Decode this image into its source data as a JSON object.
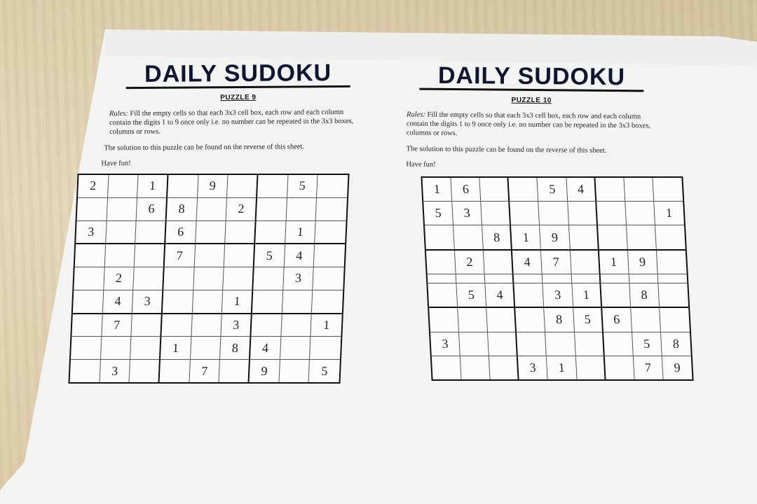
{
  "puzzles": [
    {
      "title": "DAILY SUDOKU",
      "label": "PUZZLE 9",
      "rules_prefix": "Rules:",
      "rules": "Fill the empty cells so that each 3x3 cell box, each row and each column contain the digits 1 to 9 once only i.e. no number can be repeated in the 3x3 boxes, columns or rows.",
      "solution_note": "The solution to this puzzle can be found on the reverse of this sheet.",
      "have_fun": "Have fun!",
      "grid": [
        [
          "2",
          "",
          "1",
          "",
          "9",
          "",
          "",
          "5",
          ""
        ],
        [
          "",
          "",
          "6",
          "8",
          "",
          "2",
          "",
          "",
          ""
        ],
        [
          "3",
          "",
          "",
          "6",
          "",
          "",
          "",
          "1",
          ""
        ],
        [
          "",
          "",
          "",
          "7",
          "",
          "",
          "5",
          "4",
          ""
        ],
        [
          "",
          "2",
          "",
          "",
          "",
          "",
          "",
          "3",
          ""
        ],
        [
          "",
          "4",
          "3",
          "",
          "",
          "1",
          "",
          "",
          ""
        ],
        [
          "",
          "7",
          "",
          "",
          "",
          "3",
          "",
          "",
          "1"
        ],
        [
          "",
          "",
          "",
          "1",
          "",
          "8",
          "4",
          "",
          ""
        ],
        [
          "",
          "3",
          "",
          "",
          "7",
          "",
          "9",
          "",
          "5"
        ]
      ]
    },
    {
      "title": "DAILY SUDOKU",
      "label": "PUZZLE 10",
      "rules_prefix": "Rules:",
      "rules": "Fill the empty cells so that each 3x3 cell box, each row and each column contain the digits 1 to 9 once only i.e. no number can be repeated in the 3x3 boxes, columns or rows.",
      "solution_note": "The solution to this puzzle can be found on the reverse of this sheet.",
      "have_fun": "Have fun!",
      "grid": [
        [
          "1",
          "6",
          "",
          "",
          "5",
          "4",
          "",
          "",
          ""
        ],
        [
          "5",
          "3",
          "",
          "",
          "",
          "",
          "",
          "",
          "1"
        ],
        [
          "",
          "",
          "8",
          "1",
          "9",
          "",
          "",
          "",
          ""
        ],
        [
          "",
          "2",
          "",
          "4",
          "7",
          "",
          "1",
          "9",
          ""
        ],
        [
          "",
          "",
          "",
          "",
          "",
          "",
          "",
          "",
          ""
        ],
        [
          "",
          "5",
          "4",
          "",
          "3",
          "1",
          "",
          "8",
          ""
        ],
        [
          "",
          "",
          "",
          "",
          "8",
          "5",
          "6",
          "",
          ""
        ],
        [
          "3",
          "",
          "",
          "",
          "",
          "",
          "",
          "5",
          "8"
        ],
        [
          "",
          "",
          "",
          "3",
          "1",
          "",
          "",
          "7",
          "9"
        ]
      ]
    }
  ]
}
